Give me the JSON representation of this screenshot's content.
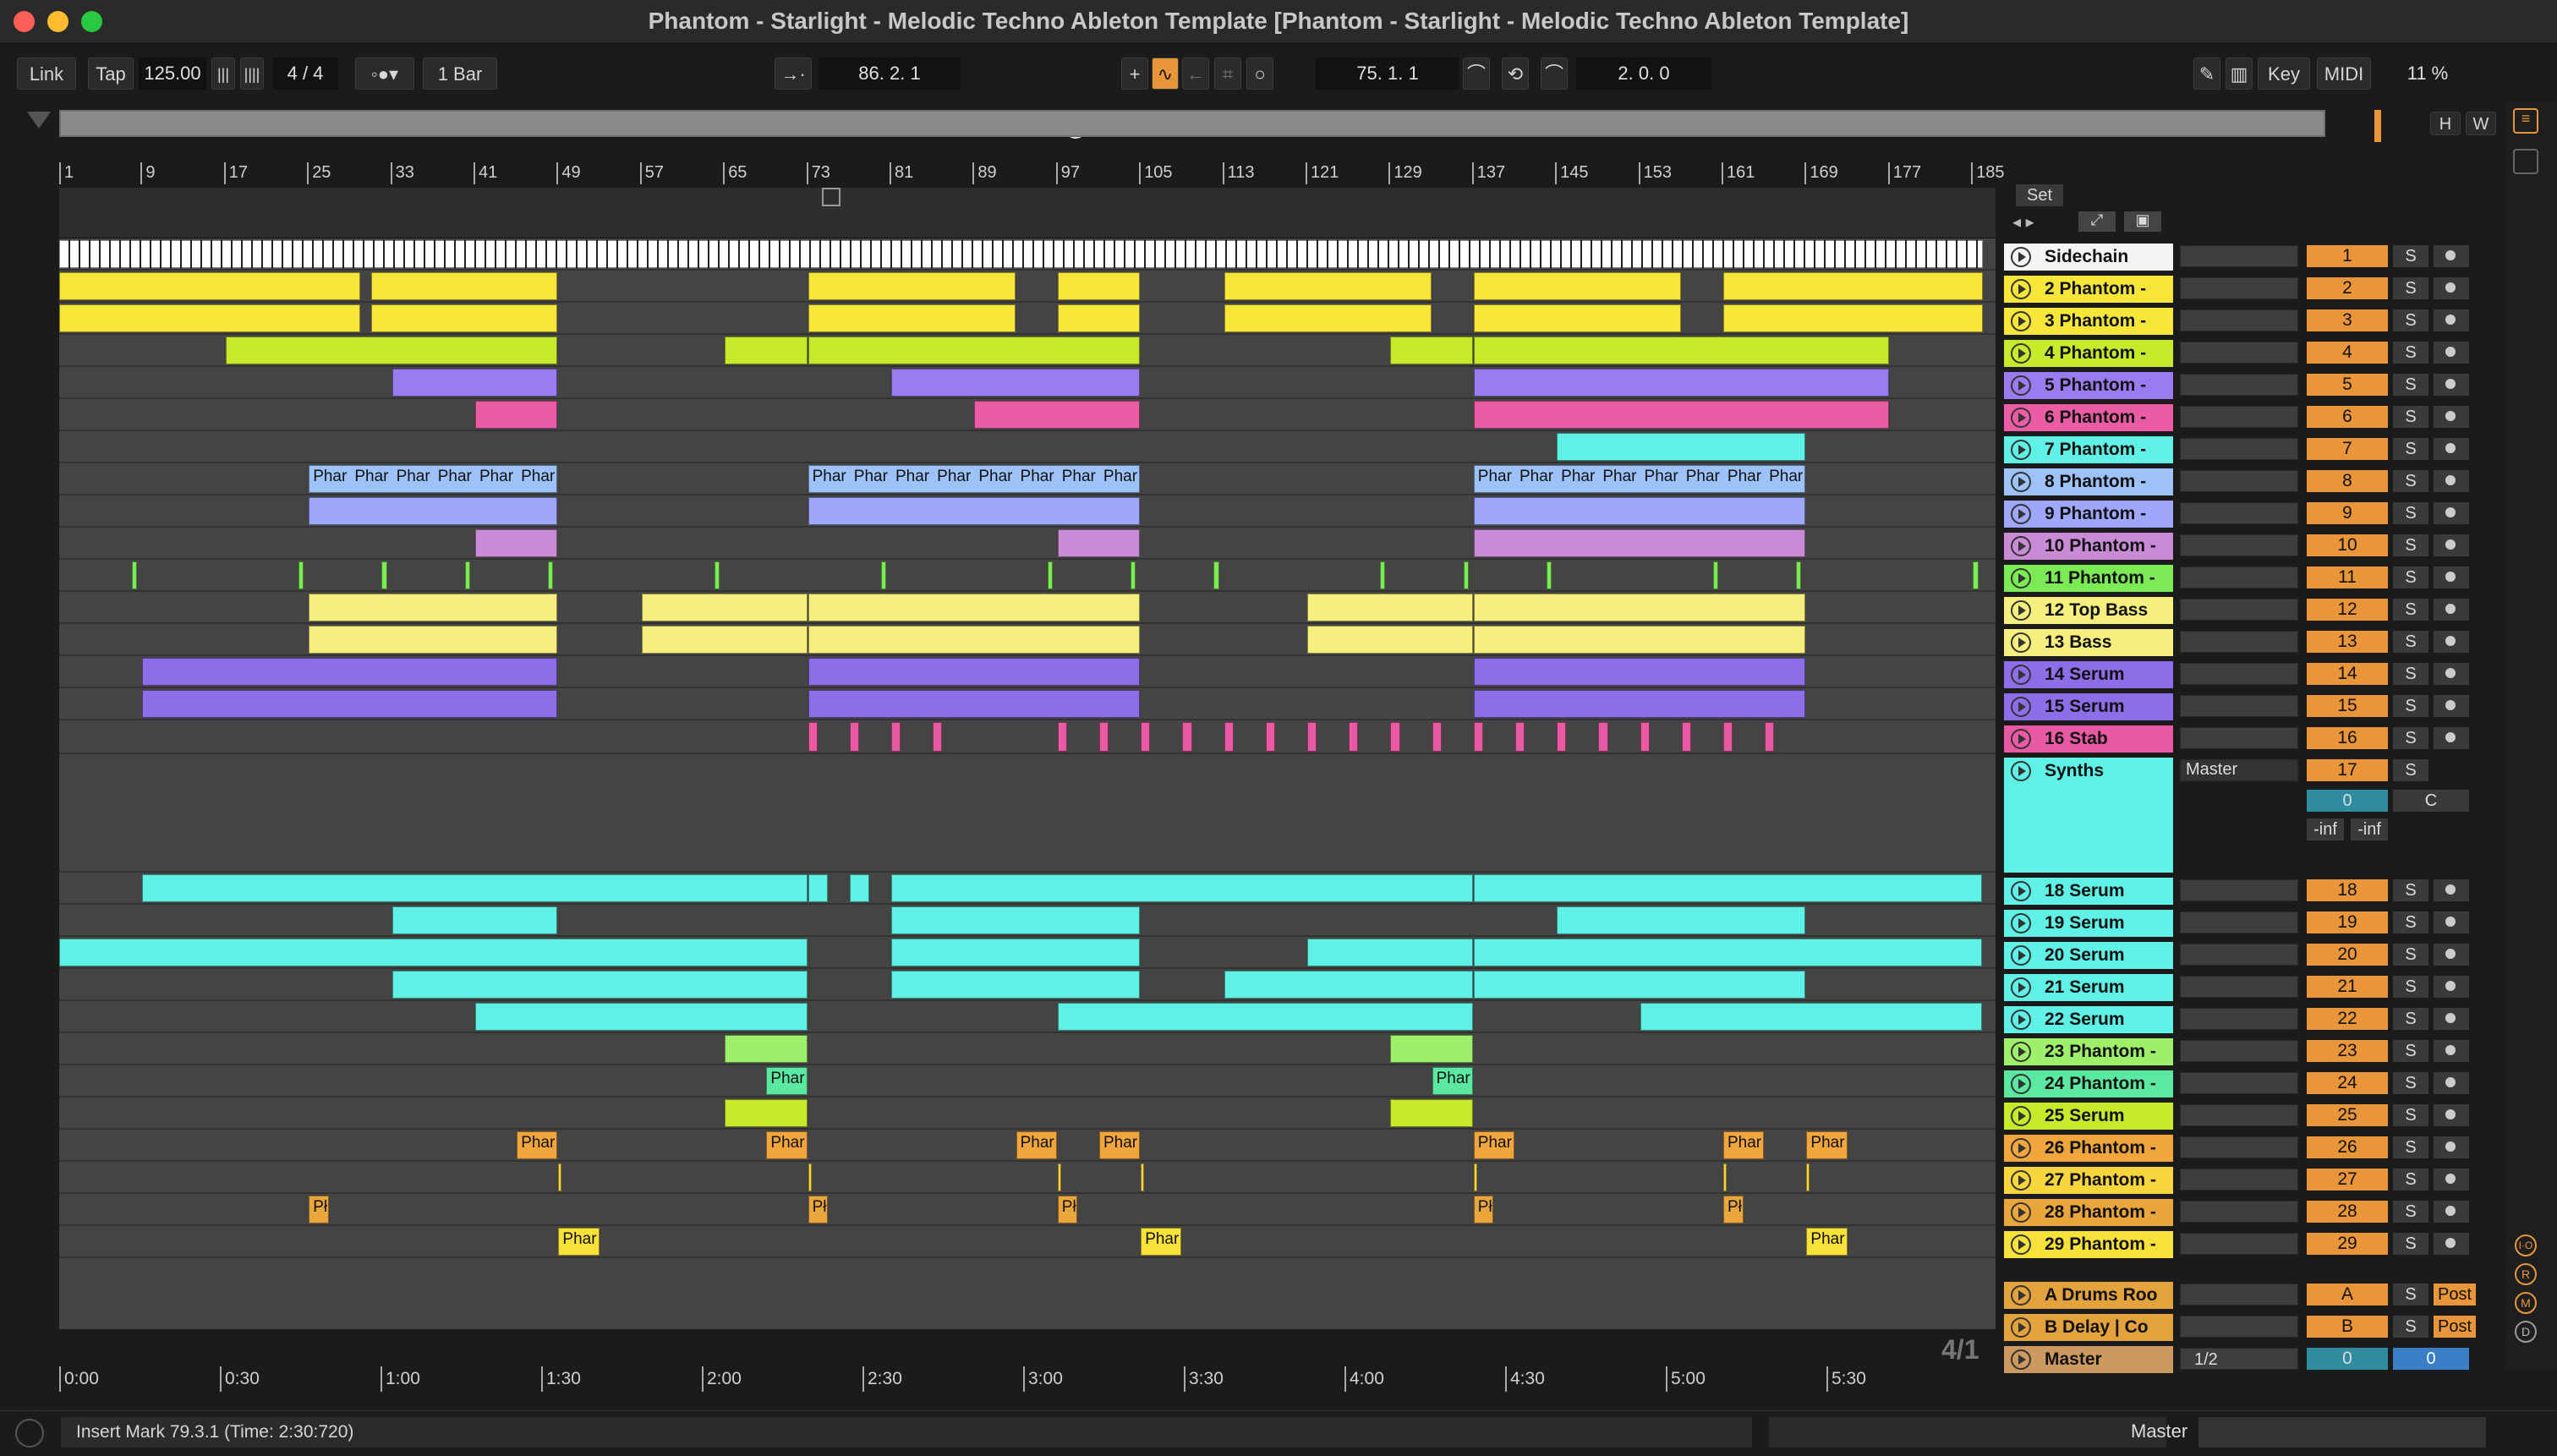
{
  "window": {
    "title": "Phantom - Starlight - Melodic Techno Ableton Template  [Phantom - Starlight - Melodic Techno Ableton Template]"
  },
  "control": {
    "link": "Link",
    "tap": "Tap",
    "tempo": "125.00",
    "signature": "4 / 4",
    "quantize": "1 Bar",
    "position": "86.  2.  1",
    "loop_start": "75.  1.  1",
    "loop_length": "2.  0.  0",
    "key": "Key",
    "midi": "MIDI",
    "cpu": "11 %"
  },
  "overview": {
    "h": "H",
    "w": "W"
  },
  "ruler": [
    "1",
    "9",
    "17",
    "25",
    "33",
    "41",
    "49",
    "57",
    "65",
    "73",
    "81",
    "89",
    "97",
    "105",
    "113",
    "121",
    "129",
    "137",
    "145",
    "153",
    "161",
    "169",
    "177",
    "185"
  ],
  "timeline": [
    "0:00",
    "0:30",
    "1:00",
    "1:30",
    "2:00",
    "2:30",
    "3:00",
    "3:30",
    "4:00",
    "4:30",
    "5:00",
    "5:30"
  ],
  "set_label": "Set",
  "tracks": [
    {
      "name": "Sidechain",
      "num": "1",
      "color": "#f4f4f4"
    },
    {
      "name": "2 Phantom -",
      "num": "2",
      "color": "#f6e63a"
    },
    {
      "name": "3 Phantom -",
      "num": "3",
      "color": "#f6e63a"
    },
    {
      "name": "4 Phantom -",
      "num": "4",
      "color": "#c7ea2b"
    },
    {
      "name": "5 Phantom -",
      "num": "5",
      "color": "#9a7cf0"
    },
    {
      "name": "6 Phantom -",
      "num": "6",
      "color": "#ea5ca4"
    },
    {
      "name": "7 Phantom -",
      "num": "7",
      "color": "#5ff1e6"
    },
    {
      "name": "8 Phantom -",
      "num": "8",
      "color": "#9cc2f7"
    },
    {
      "name": "9 Phantom -",
      "num": "9",
      "color": "#9ea7fa"
    },
    {
      "name": "10 Phantom -",
      "num": "10",
      "color": "#c98ad6"
    },
    {
      "name": "11 Phantom -",
      "num": "11",
      "color": "#7bea54"
    },
    {
      "name": "12 Top Bass",
      "num": "12",
      "color": "#f5ef7e"
    },
    {
      "name": "13 Bass",
      "num": "13",
      "color": "#f5ef7e"
    },
    {
      "name": "14 Serum",
      "num": "14",
      "color": "#8e6de8"
    },
    {
      "name": "15 Serum",
      "num": "15",
      "color": "#8e6de8"
    },
    {
      "name": "16 Stab",
      "num": "16",
      "color": "#ea5aa4"
    },
    {
      "name": "Synths",
      "num": "17",
      "color": "#5ff1e6"
    },
    {
      "name": "18 Serum",
      "num": "18",
      "color": "#5ff1e6"
    },
    {
      "name": "19 Serum",
      "num": "19",
      "color": "#5ff1e6"
    },
    {
      "name": "20 Serum",
      "num": "20",
      "color": "#5ff1e6"
    },
    {
      "name": "21 Serum",
      "num": "21",
      "color": "#5ff1e6"
    },
    {
      "name": "22 Serum",
      "num": "22",
      "color": "#5ff1e6"
    },
    {
      "name": "23 Phantom -",
      "num": "23",
      "color": "#9ef06a"
    },
    {
      "name": "24 Phantom -",
      "num": "24",
      "color": "#5be8a0"
    },
    {
      "name": "25 Serum",
      "num": "25",
      "color": "#c7ea2b"
    },
    {
      "name": "26 Phantom -",
      "num": "26",
      "color": "#f0a63c"
    },
    {
      "name": "27 Phantom -",
      "num": "27",
      "color": "#f7d53c"
    },
    {
      "name": "28 Phantom -",
      "num": "28",
      "color": "#e9a63c"
    },
    {
      "name": "29 Phantom -",
      "num": "29",
      "color": "#f7e23a"
    }
  ],
  "returns": [
    {
      "name": "A Drums Roo",
      "num": "A",
      "post": "Post"
    },
    {
      "name": "B Delay | Co",
      "num": "B",
      "post": "Post"
    }
  ],
  "master": {
    "name": "Master",
    "quant": "1/2",
    "vol": "0",
    "pan": "0"
  },
  "synths_group": {
    "routing": "Master",
    "vol": "0",
    "pan": "C",
    "inf1": "-inf",
    "inf2": "-inf"
  },
  "clip_label": "Phar",
  "clip_label_short": "Pł",
  "grid_label": "4/1",
  "solo_label": "S",
  "status": {
    "text": "Insert Mark 79.3.1 (Time: 2:30:720)",
    "master": "Master"
  }
}
